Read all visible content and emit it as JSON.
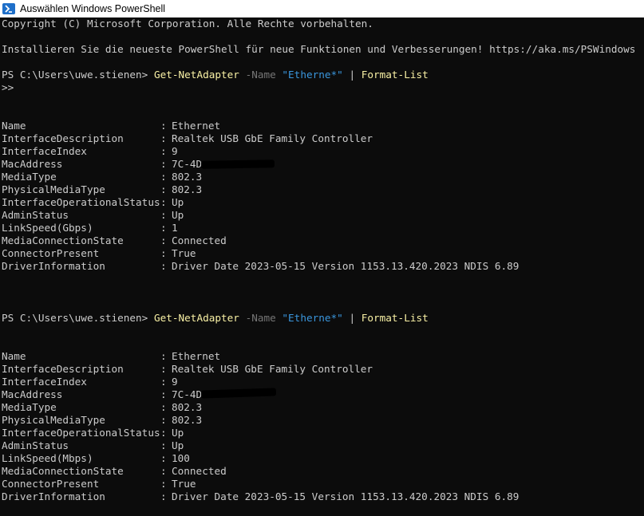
{
  "window": {
    "title": "Auswählen Windows PowerShell",
    "icon": "powershell-icon"
  },
  "console": {
    "copyright": "Copyright (C) Microsoft Corporation. Alle Rechte vorbehalten.",
    "install_notice": "Installieren Sie die neueste PowerShell für neue Funktionen und Verbesserungen! https://aka.ms/PSWindows",
    "prompt": "PS C:\\Users\\uwe.stienen> ",
    "command": {
      "cmdlet": "Get-NetAdapter",
      "param_name": "-Name",
      "param_value": "\"Etherne*\"",
      "pipe": "|",
      "format": "Format-List"
    },
    "continuation": ">>",
    "separator": ":",
    "block1": [
      {
        "prop": "Name",
        "value": "Ethernet"
      },
      {
        "prop": "InterfaceDescription",
        "value": "Realtek USB GbE Family Controller"
      },
      {
        "prop": "InterfaceIndex",
        "value": "9"
      },
      {
        "prop": "MacAddress",
        "value": "7C-4D"
      },
      {
        "prop": "MediaType",
        "value": "802.3"
      },
      {
        "prop": "PhysicalMediaType",
        "value": "802.3"
      },
      {
        "prop": "InterfaceOperationalStatus",
        "value": "Up"
      },
      {
        "prop": "AdminStatus",
        "value": "Up"
      },
      {
        "prop": "LinkSpeed(Gbps)",
        "value": "1"
      },
      {
        "prop": "MediaConnectionState",
        "value": "Connected"
      },
      {
        "prop": "ConnectorPresent",
        "value": "True"
      },
      {
        "prop": "DriverInformation",
        "value": "Driver Date 2023-05-15 Version 1153.13.420.2023 NDIS 6.89"
      }
    ],
    "block2": [
      {
        "prop": "Name",
        "value": "Ethernet"
      },
      {
        "prop": "InterfaceDescription",
        "value": "Realtek USB GbE Family Controller"
      },
      {
        "prop": "InterfaceIndex",
        "value": "9"
      },
      {
        "prop": "MacAddress",
        "value": "7C-4D"
      },
      {
        "prop": "MediaType",
        "value": "802.3"
      },
      {
        "prop": "PhysicalMediaType",
        "value": "802.3"
      },
      {
        "prop": "InterfaceOperationalStatus",
        "value": "Up"
      },
      {
        "prop": "AdminStatus",
        "value": "Up"
      },
      {
        "prop": "LinkSpeed(Mbps)",
        "value": "100"
      },
      {
        "prop": "MediaConnectionState",
        "value": "Connected"
      },
      {
        "prop": "ConnectorPresent",
        "value": "True"
      },
      {
        "prop": "DriverInformation",
        "value": "Driver Date 2023-05-15 Version 1153.13.420.2023 NDIS 6.89"
      }
    ]
  }
}
